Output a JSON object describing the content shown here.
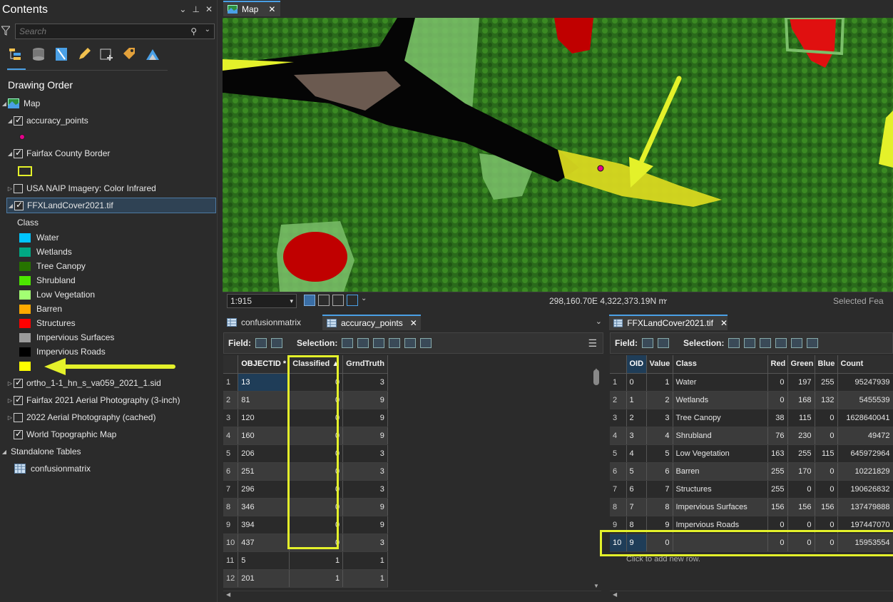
{
  "contents": {
    "title": "Contents",
    "search_placeholder": "Search",
    "drawing_order_title": "Drawing Order",
    "layers": [
      {
        "label": "Map",
        "checked": null,
        "expander": "◢"
      },
      {
        "label": "accuracy_points",
        "checked": true,
        "expander": "◢"
      },
      {
        "label": "Fairfax County Border",
        "checked": true,
        "expander": "◢"
      },
      {
        "label": "USA NAIP Imagery: Color Infrared",
        "checked": false,
        "expander": "▷"
      },
      {
        "label": "FFXLandCover2021.tif",
        "checked": true,
        "expander": "◢"
      },
      {
        "label": "ortho_1-1_hn_s_va059_2021_1.sid",
        "checked": true,
        "expander": "▷"
      },
      {
        "label": "Fairfax 2021 Aerial Photography (3-inch)",
        "checked": true,
        "expander": "▷"
      },
      {
        "label": "2022 Aerial Photography (cached)",
        "checked": false,
        "expander": "▷"
      },
      {
        "label": "World Topographic Map",
        "checked": true,
        "expander": ""
      }
    ],
    "class_heading": "Class",
    "classes": [
      {
        "label": "Water",
        "color": "#00c5ff"
      },
      {
        "label": "Wetlands",
        "color": "#00a884"
      },
      {
        "label": "Tree Canopy",
        "color": "#267300"
      },
      {
        "label": "Shrubland",
        "color": "#4ce600"
      },
      {
        "label": "Low Vegetation",
        "color": "#a3ff73"
      },
      {
        "label": "Barren",
        "color": "#ffaa00"
      },
      {
        "label": "Structures",
        "color": "#ff0000"
      },
      {
        "label": "Impervious Surfaces",
        "color": "#9c9c9c"
      },
      {
        "label": "Impervious Roads",
        "color": "#000000"
      },
      {
        "label": "",
        "color": "#ffff00"
      }
    ],
    "standalone_tables": "Standalone Tables",
    "standalone_table_item": "confusionmatrix"
  },
  "map": {
    "tab_label": "Map",
    "scale": "1:915",
    "coordinates": "298,160.70E 4,322,373.19N m",
    "selected_features": "Selected Fea"
  },
  "left_table": {
    "tabs": [
      "confusionmatrix",
      "accuracy_points"
    ],
    "field_label": "Field:",
    "selection_label": "Selection:",
    "columns": [
      "OBJECTID *",
      "Classified",
      "GrndTruth"
    ],
    "rows": [
      [
        "1",
        "13",
        "0",
        "3"
      ],
      [
        "2",
        "81",
        "0",
        "9"
      ],
      [
        "3",
        "120",
        "0",
        "9"
      ],
      [
        "4",
        "160",
        "0",
        "9"
      ],
      [
        "5",
        "206",
        "0",
        "3"
      ],
      [
        "6",
        "251",
        "0",
        "3"
      ],
      [
        "7",
        "296",
        "0",
        "3"
      ],
      [
        "8",
        "346",
        "0",
        "9"
      ],
      [
        "9",
        "394",
        "0",
        "9"
      ],
      [
        "10",
        "437",
        "0",
        "3"
      ],
      [
        "11",
        "5",
        "1",
        "1"
      ],
      [
        "12",
        "201",
        "1",
        "1"
      ]
    ]
  },
  "right_table": {
    "tab": "FFXLandCover2021.tif",
    "field_label": "Field:",
    "selection_label": "Selection:",
    "columns": [
      "OID",
      "Value",
      "Class",
      "Red",
      "Green",
      "Blue",
      "Count"
    ],
    "rows": [
      [
        "1",
        "0",
        "1",
        "Water",
        "0",
        "197",
        "255",
        "95247939"
      ],
      [
        "2",
        "1",
        "2",
        "Wetlands",
        "0",
        "168",
        "132",
        "5455539"
      ],
      [
        "3",
        "2",
        "3",
        "Tree Canopy",
        "38",
        "115",
        "0",
        "1628640041"
      ],
      [
        "4",
        "3",
        "4",
        "Shrubland",
        "76",
        "230",
        "0",
        "49472"
      ],
      [
        "5",
        "4",
        "5",
        "Low Vegetation",
        "163",
        "255",
        "115",
        "645972964"
      ],
      [
        "6",
        "5",
        "6",
        "Barren",
        "255",
        "170",
        "0",
        "10221829"
      ],
      [
        "7",
        "6",
        "7",
        "Structures",
        "255",
        "0",
        "0",
        "190626832"
      ],
      [
        "8",
        "7",
        "8",
        "Impervious Surfaces",
        "156",
        "156",
        "156",
        "137479888"
      ],
      [
        "9",
        "8",
        "9",
        "Impervious Roads",
        "0",
        "0",
        "0",
        "197447070"
      ],
      [
        "10",
        "9",
        "0",
        "",
        "0",
        "0",
        "0",
        "15953554"
      ]
    ],
    "add_row_hint": "Click to add new row."
  }
}
